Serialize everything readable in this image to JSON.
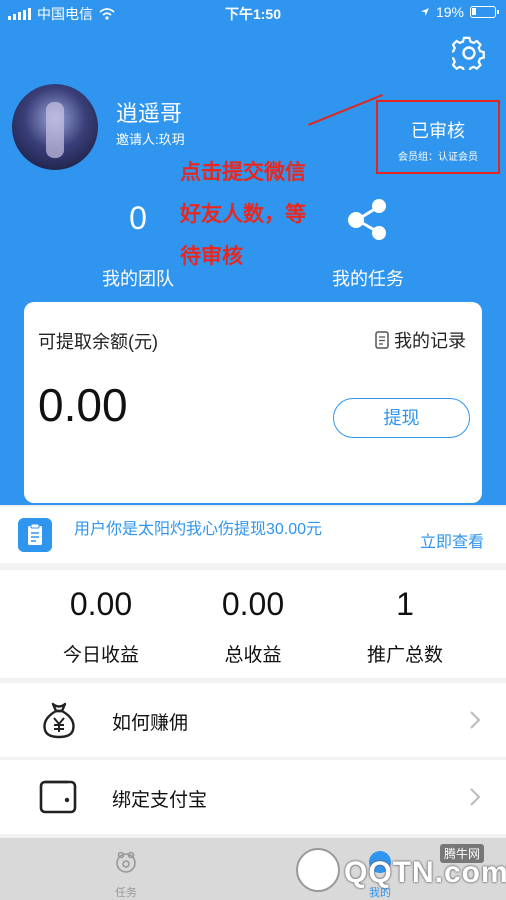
{
  "status_bar": {
    "carrier": "中国电信",
    "time": "下午1:50",
    "battery": "19%"
  },
  "profile": {
    "username": "逍遥哥",
    "inviter": "邀请人:玖玥",
    "avatar_icon": "avatar-image"
  },
  "audit": {
    "status": "已审核",
    "group": "会员组：认证会员"
  },
  "annotation": {
    "lines": [
      "点击提交微信",
      "好友人数，等",
      "待审核"
    ],
    "color": "#e8281e"
  },
  "stats": {
    "team_value": "0",
    "team_label": "我的团队",
    "task_label": "我的任务"
  },
  "balance": {
    "label": "可提取余额(元)",
    "records_label": "我的记录",
    "amount": "0.00",
    "withdraw_label": "提现"
  },
  "notice": {
    "text": "用户你是太阳灼我心伤提现30.00元",
    "link": "立即查看"
  },
  "earnings": [
    {
      "value": "0.00",
      "label": "今日收益"
    },
    {
      "value": "0.00",
      "label": "总收益"
    },
    {
      "value": "1",
      "label": "推广总数"
    }
  ],
  "menu": [
    {
      "label": "如何赚佣",
      "icon": "money-bag-icon"
    },
    {
      "label": "绑定支付宝",
      "icon": "wallet-icon"
    }
  ],
  "tabs": [
    {
      "label": "任务",
      "icon": "task-icon"
    },
    {
      "label": "我的",
      "icon": "profile-icon"
    }
  ],
  "watermark": {
    "text": "QQTN.com",
    "small": "腾牛网"
  },
  "colors": {
    "primary": "#2f95ee",
    "annotation_red": "#e0271f"
  }
}
